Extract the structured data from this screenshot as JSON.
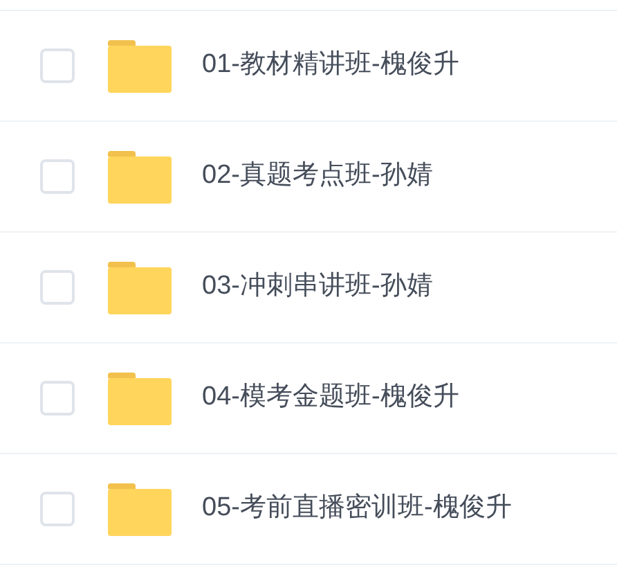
{
  "files": [
    {
      "name": "01-教材精讲班-槐俊升",
      "checked": false
    },
    {
      "name": "02-真题考点班-孙婧",
      "checked": false
    },
    {
      "name": "03-冲刺串讲班-孙婧",
      "checked": false
    },
    {
      "name": "04-模考金题班-槐俊升",
      "checked": false
    },
    {
      "name": "05-考前直播密训班-槐俊升",
      "checked": false
    }
  ]
}
